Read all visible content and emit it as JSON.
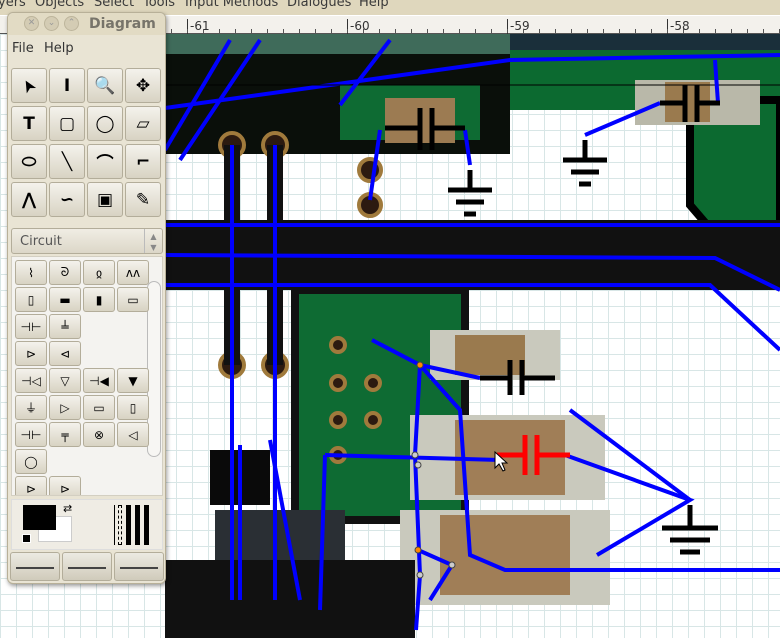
{
  "menubar": {
    "items": [
      "yers",
      "Objects",
      "Select",
      "Tools",
      "Input Methods",
      "Dialogues",
      "Help"
    ]
  },
  "ruler": {
    "labels": [
      "-61",
      "-60",
      "-59",
      "-58"
    ]
  },
  "toolbox": {
    "title": "Diagram",
    "menu": [
      "File",
      "Help"
    ],
    "tools": [
      "pointer-tool",
      "text-edit-tool",
      "magnify-tool",
      "scroll-tool",
      "text-tool",
      "box-tool",
      "ellipse-tool",
      "polygon-tool",
      "beziergon-tool",
      "line-tool",
      "arc-tool",
      "zigzagline-tool",
      "polyline-tool",
      "bezierline-tool",
      "image-tool",
      "outline-tool"
    ],
    "sheet": "Circuit",
    "shapes": [
      "vertical-inductor",
      "horizontal-inductor",
      "vertical-coil",
      "horizontal-resistor-zigzag",
      "vertical-resistor",
      "horizontal-resistor-filled",
      "vertical-resistor-filled",
      "horizontal-resistor",
      "horizontal-capacitor",
      "vertical-capacitor",
      "npn-transistor",
      "pnp-transistor",
      "horizontal-diode",
      "vertical-diode",
      "horizontal-zener",
      "vertical-zener",
      "ground",
      "opamp",
      "horizontal-fuse",
      "vertical-fuse",
      "horizontal-polarized-capacitor",
      "vertical-polarized-capacitor",
      "lamp",
      "speaker",
      "microphone",
      "led",
      "photodiode"
    ],
    "colors": {
      "foreground": "#000000",
      "background": "#ffffff"
    }
  },
  "colors": {
    "wire": "#0000ff",
    "selected": "#ff0000",
    "pcb": "#0e6b33",
    "accent": "#dfd7bd"
  }
}
